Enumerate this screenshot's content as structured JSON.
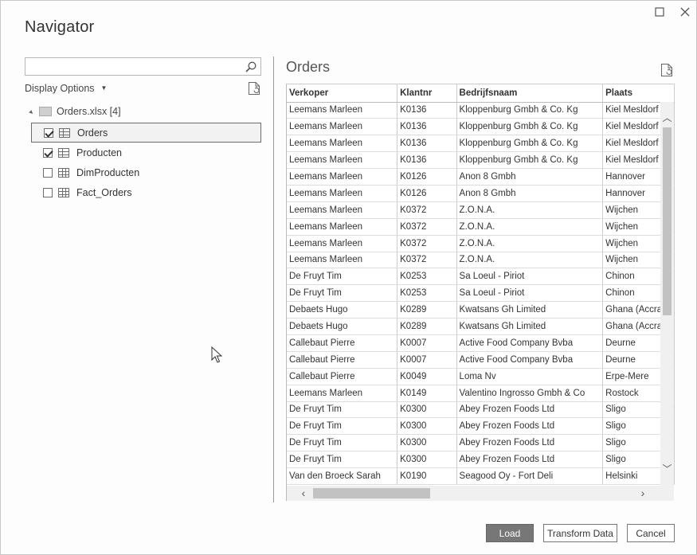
{
  "window": {
    "title": "Navigator",
    "maximize_icon": "maximize-icon",
    "close_icon": "close-icon"
  },
  "left_pane": {
    "search": {
      "value": "",
      "placeholder": ""
    },
    "display_options_label": "Display Options",
    "tree": {
      "root_label": "Orders.xlsx [4]",
      "items": [
        {
          "label": "Orders",
          "checked": true,
          "selected": true,
          "icon": "table-icon"
        },
        {
          "label": "Producten",
          "checked": true,
          "selected": false,
          "icon": "table-icon"
        },
        {
          "label": "DimProducten",
          "checked": false,
          "selected": false,
          "icon": "named-range-icon"
        },
        {
          "label": "Fact_Orders",
          "checked": false,
          "selected": false,
          "icon": "named-range-icon"
        }
      ]
    }
  },
  "preview": {
    "title": "Orders",
    "columns": [
      "Verkoper",
      "Klantnr",
      "Bedrijfsnaam",
      "Plaats"
    ],
    "rows": [
      [
        "Leemans Marleen",
        "K0136",
        "Kloppenburg Gmbh & Co. Kg",
        "Kiel Mesldorf"
      ],
      [
        "Leemans Marleen",
        "K0136",
        "Kloppenburg Gmbh & Co. Kg",
        "Kiel Mesldorf"
      ],
      [
        "Leemans Marleen",
        "K0136",
        "Kloppenburg Gmbh & Co. Kg",
        "Kiel Mesldorf"
      ],
      [
        "Leemans Marleen",
        "K0136",
        "Kloppenburg Gmbh & Co. Kg",
        "Kiel Mesldorf"
      ],
      [
        "Leemans Marleen",
        "K0126",
        "Anon 8 Gmbh",
        "Hannover"
      ],
      [
        "Leemans Marleen",
        "K0126",
        "Anon 8 Gmbh",
        "Hannover"
      ],
      [
        "Leemans Marleen",
        "K0372",
        "Z.O.N.A.",
        "Wijchen"
      ],
      [
        "Leemans Marleen",
        "K0372",
        "Z.O.N.A.",
        "Wijchen"
      ],
      [
        "Leemans Marleen",
        "K0372",
        "Z.O.N.A.",
        "Wijchen"
      ],
      [
        "Leemans Marleen",
        "K0372",
        "Z.O.N.A.",
        "Wijchen"
      ],
      [
        "De Fruyt Tim",
        "K0253",
        "Sa Loeul - Piriot",
        "Chinon"
      ],
      [
        "De Fruyt Tim",
        "K0253",
        "Sa Loeul - Piriot",
        "Chinon"
      ],
      [
        "Debaets Hugo",
        "K0289",
        "Kwatsans Gh Limited",
        "Ghana (Accra)"
      ],
      [
        "Debaets Hugo",
        "K0289",
        "Kwatsans Gh Limited",
        "Ghana (Accra)"
      ],
      [
        "Callebaut Pierre",
        "K0007",
        "Active Food Company Bvba",
        "Deurne"
      ],
      [
        "Callebaut Pierre",
        "K0007",
        "Active Food Company Bvba",
        "Deurne"
      ],
      [
        "Callebaut Pierre",
        "K0049",
        "Loma Nv",
        "Erpe-Mere"
      ],
      [
        "Leemans Marleen",
        "K0149",
        "Valentino Ingrosso Gmbh & Co",
        "Rostock"
      ],
      [
        "De Fruyt Tim",
        "K0300",
        "Abey Frozen Foods Ltd",
        "Sligo"
      ],
      [
        "De Fruyt Tim",
        "K0300",
        "Abey Frozen Foods Ltd",
        "Sligo"
      ],
      [
        "De Fruyt Tim",
        "K0300",
        "Abey Frozen Foods Ltd",
        "Sligo"
      ],
      [
        "De Fruyt Tim",
        "K0300",
        "Abey Frozen Foods Ltd",
        "Sligo"
      ],
      [
        "Van den Broeck Sarah",
        "K0190",
        "Seagood Oy - Fort Deli",
        "Helsinki"
      ]
    ],
    "vertical_scroll_fraction": 0.0,
    "horizontal_scroll_fraction": 0.0
  },
  "footer": {
    "load_label": "Load",
    "transform_label": "Transform Data",
    "cancel_label": "Cancel"
  }
}
